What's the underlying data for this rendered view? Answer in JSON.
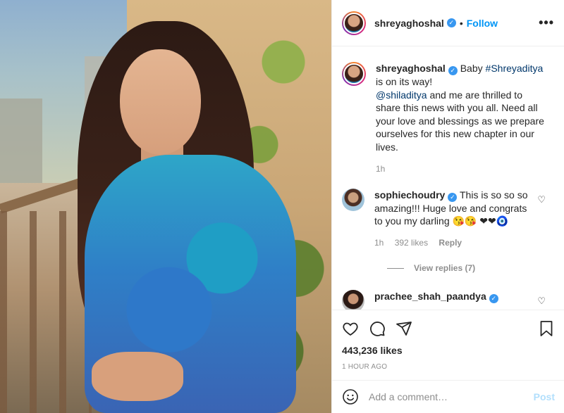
{
  "post": {
    "username": "shreyaghoshal",
    "follow_label": "Follow",
    "more_label": "•••",
    "caption_username": "shreyaghoshal",
    "caption_prefix": "Baby ",
    "caption_hashtag": "#Shreyaditya",
    "caption_line1_end": " is on its way!",
    "caption_mention": "@shiladitya",
    "caption_rest": " and me are thrilled to share this news with you all. Need all your love and blessings as we prepare ourselves for this new chapter in our lives.",
    "caption_time": "1h"
  },
  "comments": [
    {
      "username": "sophiechoudry",
      "text": "This is so so so amazing!!! Huge love and congrats to you my darling 😘😘 ❤❤🧿",
      "time": "1h",
      "likes": "392 likes",
      "reply_label": "Reply",
      "view_replies": "View replies (7)"
    },
    {
      "username": "prachee_shah_paandya"
    }
  ],
  "actions": {
    "likes": "443,236 likes",
    "time_ago": "1 HOUR AGO"
  },
  "add_comment": {
    "placeholder": "Add a comment…",
    "post_label": "Post"
  }
}
